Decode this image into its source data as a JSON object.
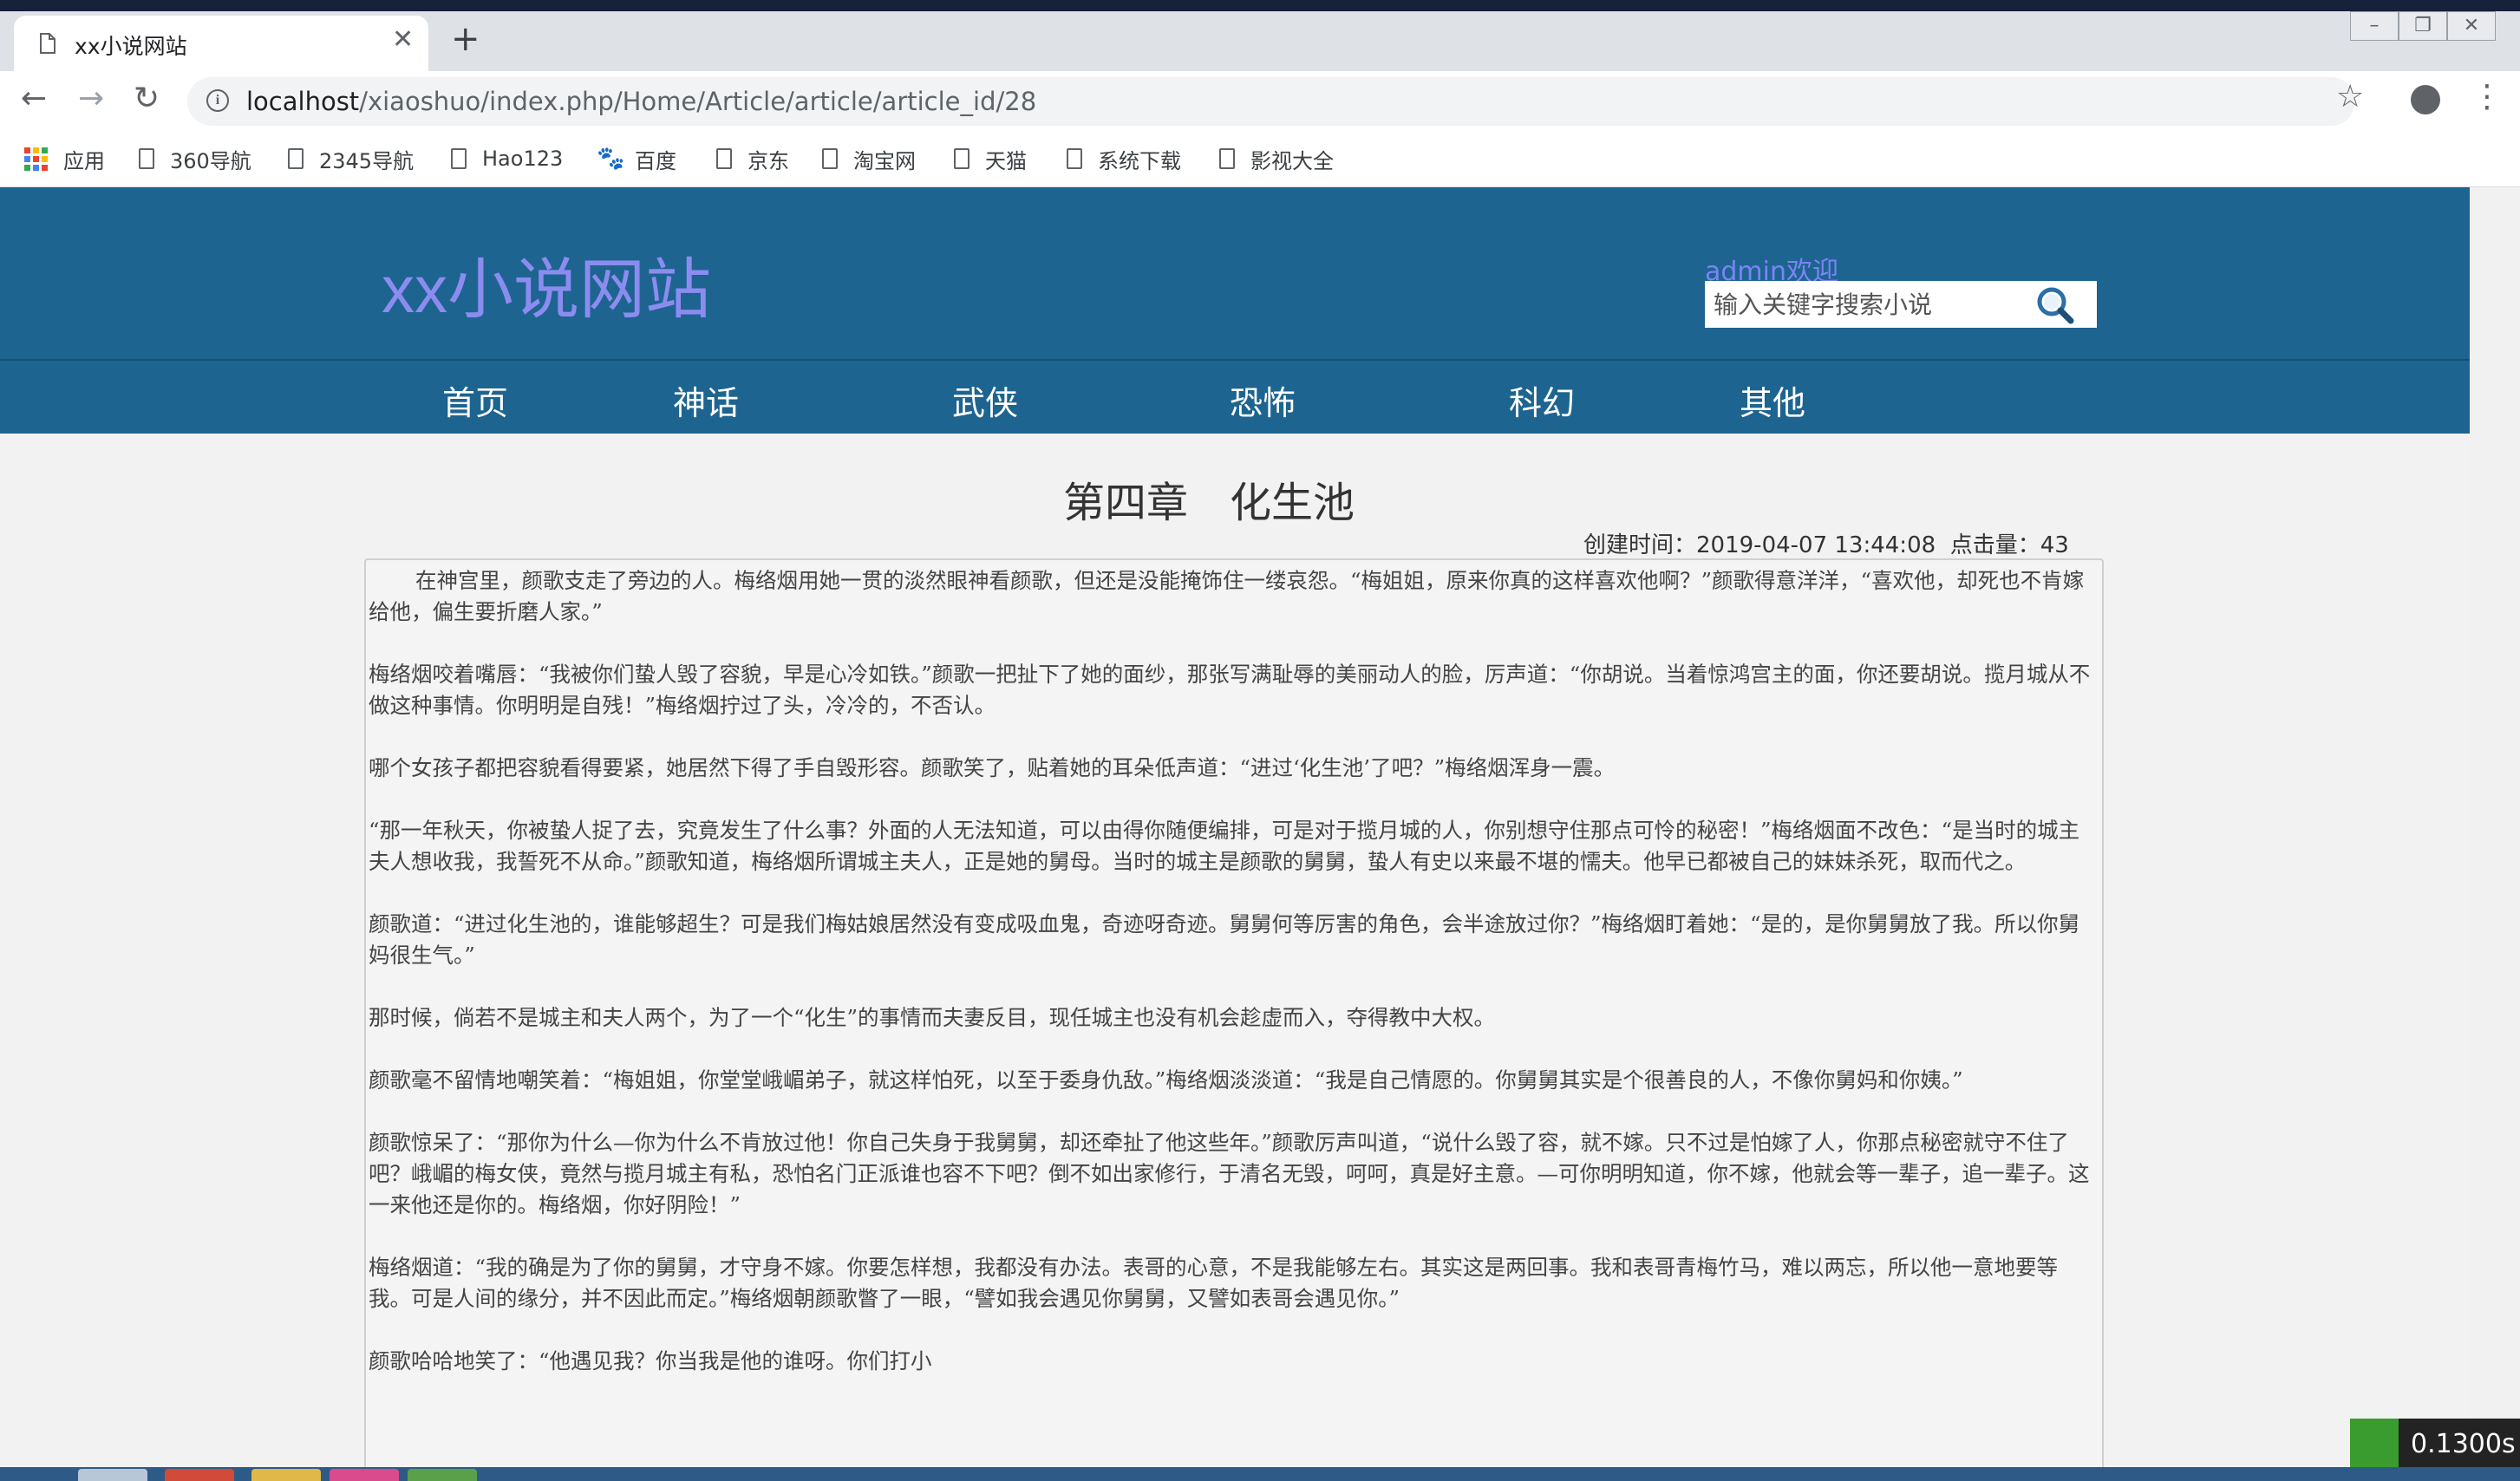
{
  "browser": {
    "tab_title": "xx小说网站",
    "url_host": "localhost",
    "url_path": "/xiaoshuo/index.php/Home/Article/article/article_id/28",
    "bookmarks": [
      "应用",
      "360导航",
      "2345导航",
      "Hao123",
      "百度",
      "京东",
      "淘宝网",
      "天猫",
      "系统下载",
      "影视大全"
    ]
  },
  "site": {
    "logo": "xx小说网站",
    "welcome": "admin欢迎",
    "search_placeholder": "输入关键字搜索小说",
    "nav": [
      "首页",
      "神话",
      "武侠",
      "恐怖",
      "科幻",
      "其他"
    ]
  },
  "article": {
    "title": "第四章　化生池",
    "meta_label_created": "创建时间：",
    "created": "2019-04-07 13:44:08",
    "meta_label_clicks": "点击量：",
    "clicks": "43",
    "paragraphs": [
      "在神宫里，颜歌支走了旁边的人。梅络烟用她一贯的淡然眼神看颜歌，但还是没能掩饰住一缕哀怨。“梅姐姐，原来你真的这样喜欢他啊？”颜歌得意洋洋，“喜欢他，却死也不肯嫁给他，偏生要折磨人家。”",
      "梅络烟咬着嘴唇：“我被你们蛰人毁了容貌，早是心冷如铁。”颜歌一把扯下了她的面纱，那张写满耻辱的美丽动人的脸，厉声道：“你胡说。当着惊鸿宫主的面，你还要胡说。揽月城从不做这种事情。你明明是自残！”梅络烟拧过了头，冷冷的，不否认。",
      "哪个女孩子都把容貌看得要紧，她居然下得了手自毁形容。颜歌笑了，贴着她的耳朵低声道：“进过‘化生池’了吧？”梅络烟浑身一震。",
      "“那一年秋天，你被蛰人捉了去，究竟发生了什么事？外面的人无法知道，可以由得你随便编排，可是对于揽月城的人，你别想守住那点可怜的秘密！”梅络烟面不改色：“是当时的城主夫人想收我，我誓死不从命。”颜歌知道，梅络烟所谓城主夫人，正是她的舅母。当时的城主是颜歌的舅舅，蛰人有史以来最不堪的懦夫。他早已都被自己的妹妹杀死，取而代之。",
      "颜歌道：“进过化生池的，谁能够超生？可是我们梅姑娘居然没有变成吸血鬼，奇迹呀奇迹。舅舅何等厉害的角色，会半途放过你？”梅络烟盯着她：“是的，是你舅舅放了我。所以你舅妈很生气。”",
      "那时候，倘若不是城主和夫人两个，为了一个“化生”的事情而夫妻反目，现任城主也没有机会趁虚而入，夺得教中大权。",
      "颜歌毫不留情地嘲笑着：“梅姐姐，你堂堂峨嵋弟子，就这样怕死，以至于委身仇敌。”梅络烟淡淡道：“我是自己情愿的。你舅舅其实是个很善良的人，不像你舅妈和你姨。”",
      "颜歌惊呆了：“那你为什么—你为什么不肯放过他！你自己失身于我舅舅，却还牵扯了他这些年。”颜歌厉声叫道，“说什么毁了容，就不嫁。只不过是怕嫁了人，你那点秘密就守不住了吧？峨嵋的梅女侠，竟然与揽月城主有私，恐怕名门正派谁也容不下吧？倒不如出家修行，于清名无毁，呵呵，真是好主意。—可你明明知道，你不嫁，他就会等一辈子，追一辈子。这一来他还是你的。梅络烟，你好阴险！”",
      "梅络烟道：“我的确是为了你的舅舅，才守身不嫁。你要怎样想，我都没有办法。表哥的心意，不是我能够左右。其实这是两回事。我和表哥青梅竹马，难以两忘，所以他一意地要等我。可是人间的缘分，并不因此而定。”梅络烟朝颜歌瞥了一眼，“譬如我会遇见你舅舅，又譬如表哥会遇见你。”",
      "颜歌哈哈地笑了：“他遇见我？你当我是他的谁呀。你们打小"
    ]
  },
  "perf_badge": "0.1300s"
}
